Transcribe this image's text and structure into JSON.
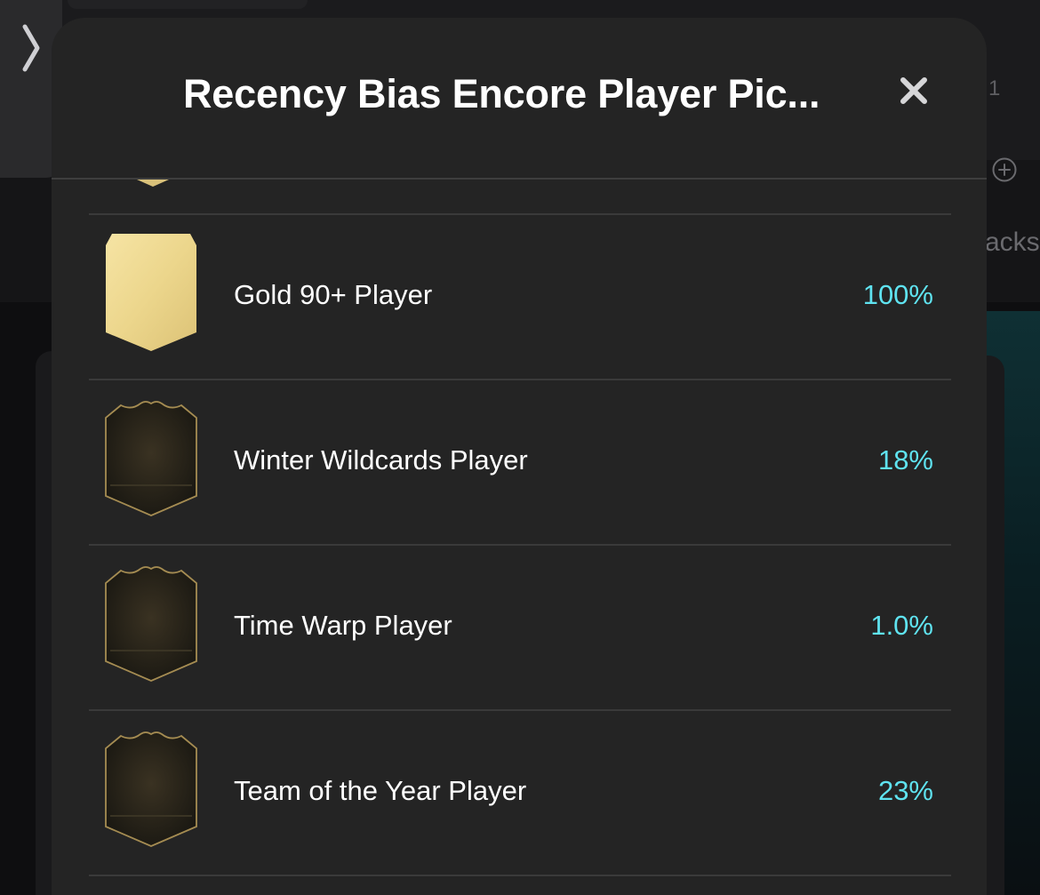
{
  "modal": {
    "title": "Recency Bias Encore Player Pic...",
    "close_glyph": "✕"
  },
  "background": {
    "count": "1",
    "packs_text": "acks"
  },
  "accent_color": "#5fe3f0",
  "items": [
    {
      "label": "Gold 90+ Player",
      "value": "100%",
      "card_style": "gold"
    },
    {
      "label": "Winter Wildcards Player",
      "value": "18%",
      "card_style": "special-dark"
    },
    {
      "label": "Time Warp Player",
      "value": "1.0%",
      "card_style": "special-dark"
    },
    {
      "label": "Team of the Year Player",
      "value": "23%",
      "card_style": "special-dark"
    }
  ]
}
